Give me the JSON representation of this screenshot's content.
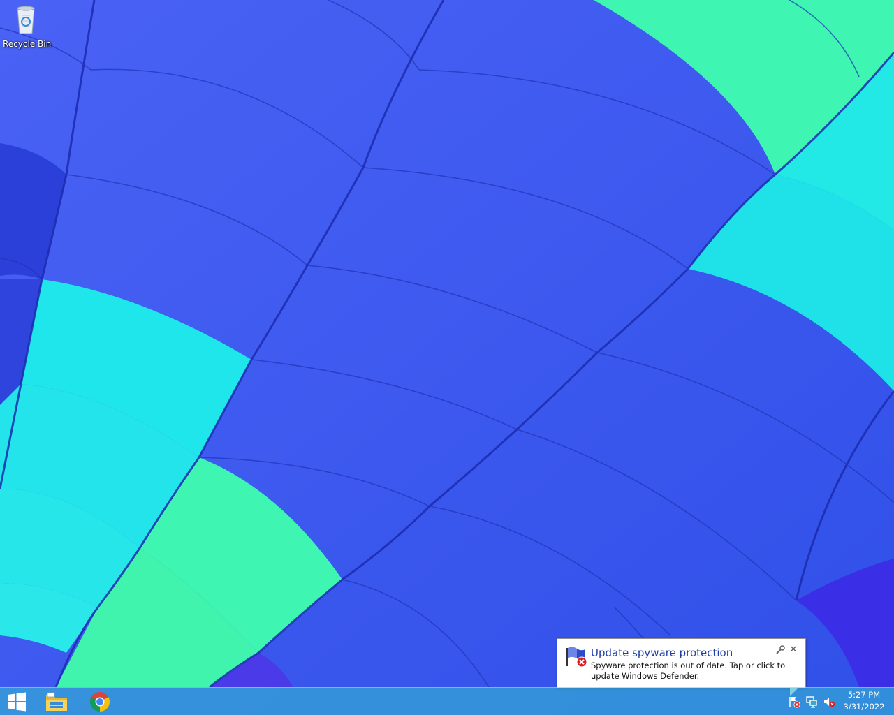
{
  "desktop": {
    "icons": [
      {
        "label": "Recycle Bin",
        "icon": "recycle-bin-icon"
      }
    ]
  },
  "taskbar": {
    "start": {
      "icon": "windows-logo-icon"
    },
    "pinned": [
      {
        "icon": "file-explorer-icon"
      },
      {
        "icon": "chrome-icon"
      }
    ],
    "tray": {
      "icons": [
        "action-center-flag-error-icon",
        "network-icon",
        "speaker-muted-icon"
      ],
      "time": "5:27 PM",
      "date": "3/31/2022"
    }
  },
  "notification": {
    "title": "Update spyware protection",
    "message": "Spyware protection is out of date. Tap or click to update Windows Defender.",
    "icon": "windows-defender-flag-error-icon"
  },
  "colors": {
    "wallpaper_blue": "#3a5cf0",
    "wallpaper_cyan": "#18e6ec",
    "wallpaper_green": "#3ff5b0",
    "taskbar": "#34b4d2",
    "notification_title": "#1f3fa6"
  }
}
